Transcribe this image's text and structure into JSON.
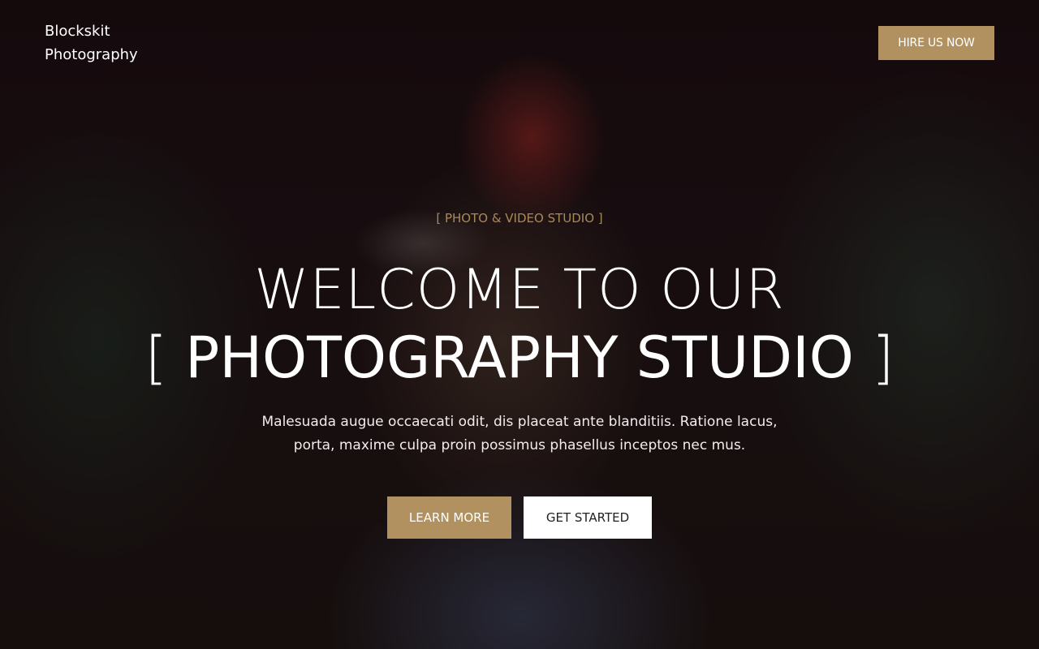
{
  "header": {
    "brand_line1": "Blockskit",
    "brand_line2": "Photography",
    "hire_label": "HIRE US NOW"
  },
  "hero": {
    "subtitle": "[ PHOTO & VIDEO STUDIO ]",
    "title_line1": "WELCOME TO OUR",
    "title_line2_open": "[",
    "title_line2_text": "PHOTOGRAPHY STUDIO",
    "title_line2_close": "]",
    "description_line1": "Malesuada augue occaecati odit, dis placeat ante blanditiis. Ratione lacus,",
    "description_line2": "porta, maxime culpa proin possimus phasellus inceptos nec mus.",
    "learn_more_label": "LEARN MORE",
    "get_started_label": "GET STARTED"
  },
  "colors": {
    "accent": "#b0915f",
    "subtitle": "#a88a58",
    "overlay": "#140a0c"
  }
}
